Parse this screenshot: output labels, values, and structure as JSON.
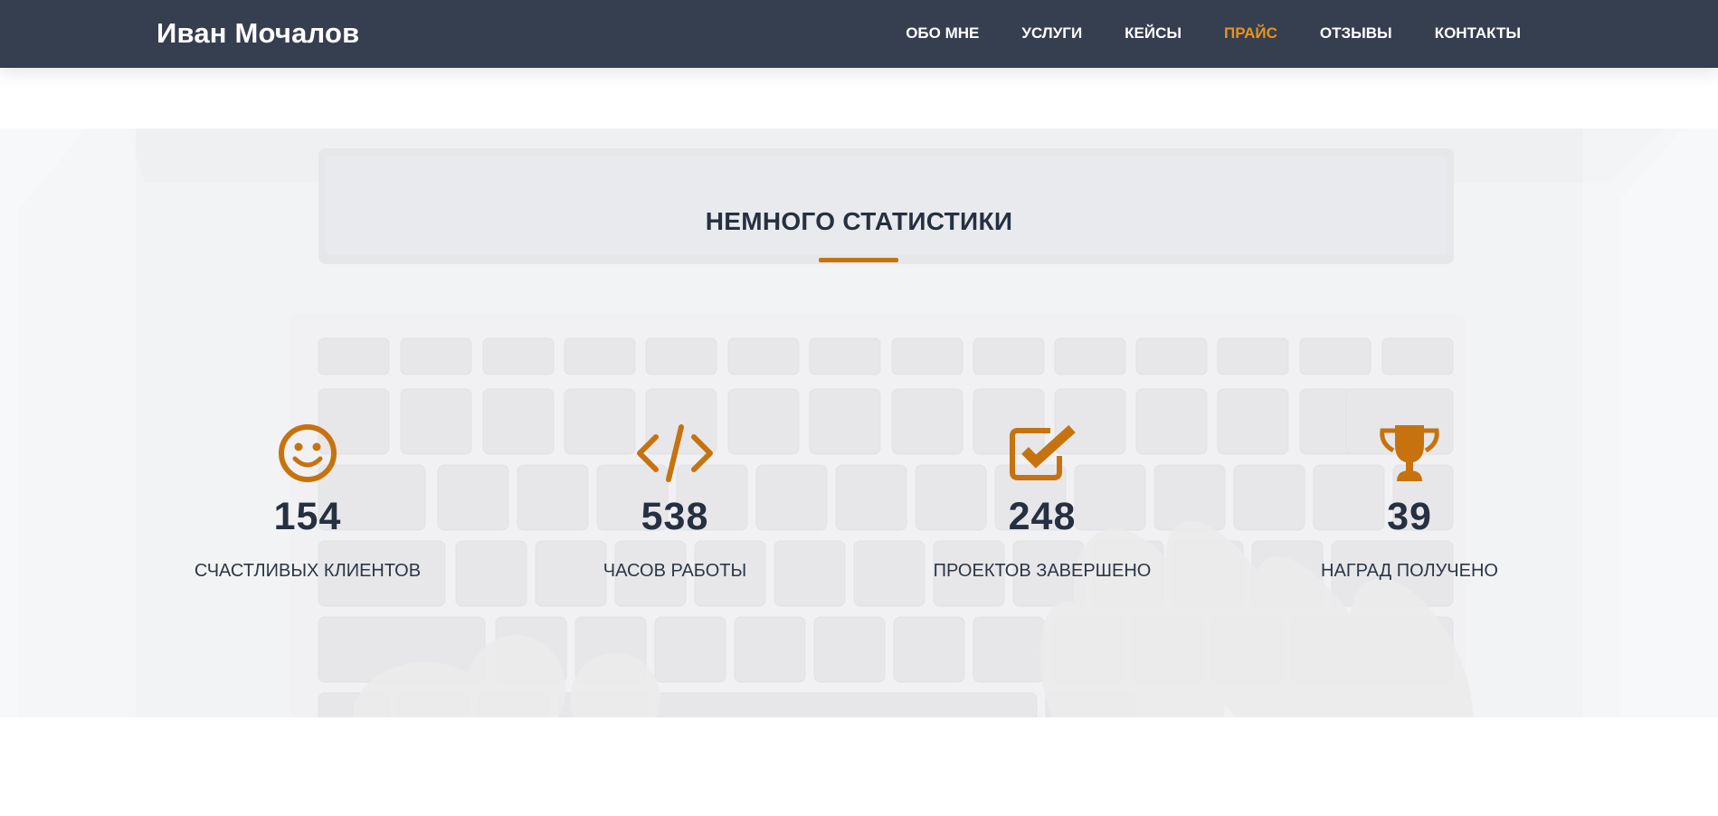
{
  "brand": {
    "name": "Иван Мочалов"
  },
  "nav": {
    "items": [
      {
        "label": "ОБО МНЕ",
        "active": false
      },
      {
        "label": "УСЛУГИ",
        "active": false
      },
      {
        "label": "КЕЙСЫ",
        "active": false
      },
      {
        "label": "ПРАЙС",
        "active": true
      },
      {
        "label": "ОТЗЫВЫ",
        "active": false
      },
      {
        "label": "КОНТАКТЫ",
        "active": false
      }
    ]
  },
  "stats": {
    "title": "НЕМНОГО СТАТИСТИКИ",
    "items": [
      {
        "icon": "smile-icon",
        "value": "154",
        "label": "СЧАСТЛИВЫХ КЛИЕНТОВ"
      },
      {
        "icon": "code-icon",
        "value": "538",
        "label": "ЧАСОВ РАБОТЫ"
      },
      {
        "icon": "checkbox-icon",
        "value": "248",
        "label": "ПРОЕКТОВ ЗАВЕРШЕНО"
      },
      {
        "icon": "trophy-icon",
        "value": "39",
        "label": "НАГРАД ПОЛУЧЕНО"
      }
    ]
  },
  "colors": {
    "navbar_bg": "#353f50",
    "accent": "#c6730f",
    "nav_active": "#e8931e",
    "text_dark": "#253040"
  }
}
